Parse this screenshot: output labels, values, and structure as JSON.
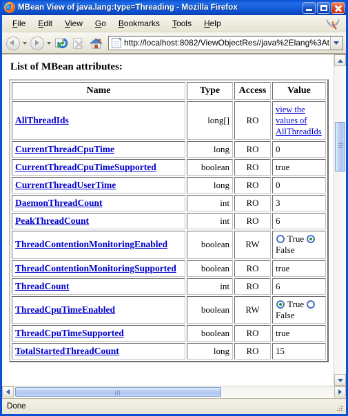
{
  "window": {
    "title": "MBean View of java.lang:type=Threading - Mozilla Firefox",
    "logo_icon": "firefox-logo-icon",
    "controls": {
      "minimize_label": "Minimize",
      "maximize_label": "Maximize",
      "close_label": "Close"
    }
  },
  "menubar": {
    "items": [
      {
        "label": "File",
        "accel": "F"
      },
      {
        "label": "Edit",
        "accel": "E"
      },
      {
        "label": "View",
        "accel": "V"
      },
      {
        "label": "Go",
        "accel": "G"
      },
      {
        "label": "Bookmarks",
        "accel": "B"
      },
      {
        "label": "Tools",
        "accel": "T"
      },
      {
        "label": "Help",
        "accel": "H"
      }
    ],
    "throbber_icon": "firefox-throbber-icon"
  },
  "toolbar": {
    "back_icon": "back-arrow-icon",
    "forward_icon": "forward-arrow-icon",
    "reload_icon": "reload-icon",
    "stop_icon": "stop-icon",
    "home_icon": "home-icon",
    "dropdown_icon": "chevron-down-icon"
  },
  "urlbar": {
    "page_icon": "page-document-icon",
    "value": "http://localhost:8082/ViewObjectRes//java%2Elang%3At",
    "placeholder": "",
    "dropdown_icon": "chevron-down-icon"
  },
  "page": {
    "heading": "List of MBean attributes:",
    "table": {
      "columns": [
        "Name",
        "Type",
        "Access",
        "Value"
      ],
      "rows": [
        {
          "name": "AllThreadIds",
          "type": "long[]",
          "access": "RO",
          "value_kind": "link",
          "value": "view the values of AllThreadIds"
        },
        {
          "name": "CurrentThreadCpuTime",
          "type": "long",
          "access": "RO",
          "value_kind": "text",
          "value": "0"
        },
        {
          "name": "CurrentThreadCpuTimeSupported",
          "type": "boolean",
          "access": "RO",
          "value_kind": "text",
          "value": "true"
        },
        {
          "name": "CurrentThreadUserTime",
          "type": "long",
          "access": "RO",
          "value_kind": "text",
          "value": "0"
        },
        {
          "name": "DaemonThreadCount",
          "type": "int",
          "access": "RO",
          "value_kind": "text",
          "value": "3"
        },
        {
          "name": "PeakThreadCount",
          "type": "int",
          "access": "RO",
          "value_kind": "text",
          "value": "6"
        },
        {
          "name": "ThreadContentionMonitoringEnabled",
          "type": "boolean",
          "access": "RW",
          "value_kind": "radio",
          "true_label": "True",
          "false_label": "False",
          "selected": "False"
        },
        {
          "name": "ThreadContentionMonitoringSupported",
          "type": "boolean",
          "access": "RO",
          "value_kind": "text",
          "value": "true"
        },
        {
          "name": "ThreadCount",
          "type": "int",
          "access": "RO",
          "value_kind": "text",
          "value": "6"
        },
        {
          "name": "ThreadCpuTimeEnabled",
          "type": "boolean",
          "access": "RW",
          "value_kind": "radio",
          "true_label": "True",
          "false_label": "False",
          "selected": "True"
        },
        {
          "name": "ThreadCpuTimeSupported",
          "type": "boolean",
          "access": "RO",
          "value_kind": "text",
          "value": "true"
        },
        {
          "name": "TotalStartedThreadCount",
          "type": "long",
          "access": "RO",
          "value_kind": "text",
          "value": "15"
        }
      ]
    }
  },
  "scrollbars": {
    "vertical": {
      "up_icon": "scroll-up-icon",
      "down_icon": "scroll-down-icon"
    },
    "horizontal": {
      "left_icon": "scroll-left-icon",
      "right_icon": "scroll-right-icon"
    }
  },
  "statusbar": {
    "text": "Done",
    "grip_icon": "resize-grip-icon"
  },
  "colors": {
    "title_bar": "#0a50d2",
    "link": "#0000cc",
    "chrome": "#ece9d8",
    "page_bg": "#ffffff",
    "radio_ring": "#4a6fc4",
    "radio_dot": "#16a016"
  }
}
